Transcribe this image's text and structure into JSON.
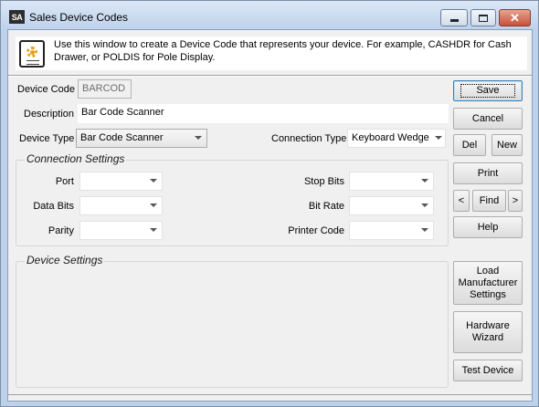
{
  "window": {
    "app_icon": "SA",
    "title": "Sales Device Codes",
    "controls": {
      "minimize": "minimize-icon",
      "maximize": "maximize-icon",
      "close": "close-icon"
    },
    "close_color": "#c75138"
  },
  "info": {
    "icon": "device-settings-icon",
    "text": "Use this window to create a Device Code that represents your device. For example, CASHDR for Cash Drawer, or POLDIS for Pole Display."
  },
  "form": {
    "device_code": {
      "label": "Device Code",
      "value": "BARCOD"
    },
    "description": {
      "label": "Description",
      "value": "Bar Code Scanner"
    },
    "device_type": {
      "label": "Device Type",
      "value": "Bar Code Scanner"
    },
    "connection_type": {
      "label": "Connection Type",
      "value": "Keyboard Wedge"
    }
  },
  "connection_settings": {
    "title": "Connection Settings",
    "port": {
      "label": "Port",
      "value": ""
    },
    "data_bits": {
      "label": "Data Bits",
      "value": ""
    },
    "parity": {
      "label": "Parity",
      "value": ""
    },
    "stop_bits": {
      "label": "Stop Bits",
      "value": ""
    },
    "bit_rate": {
      "label": "Bit Rate",
      "value": ""
    },
    "printer_code": {
      "label": "Printer Code",
      "value": ""
    }
  },
  "device_settings": {
    "title": "Device Settings"
  },
  "buttons": {
    "save": "Save",
    "cancel": "Cancel",
    "delete": "Del",
    "new": "New",
    "print": "Print",
    "prev": "<",
    "find": "Find",
    "next": ">",
    "help": "Help",
    "load_manufacturer": "Load Manufacturer Settings",
    "hardware_wizard": "Hardware Wizard",
    "test_device": "Test Device"
  }
}
